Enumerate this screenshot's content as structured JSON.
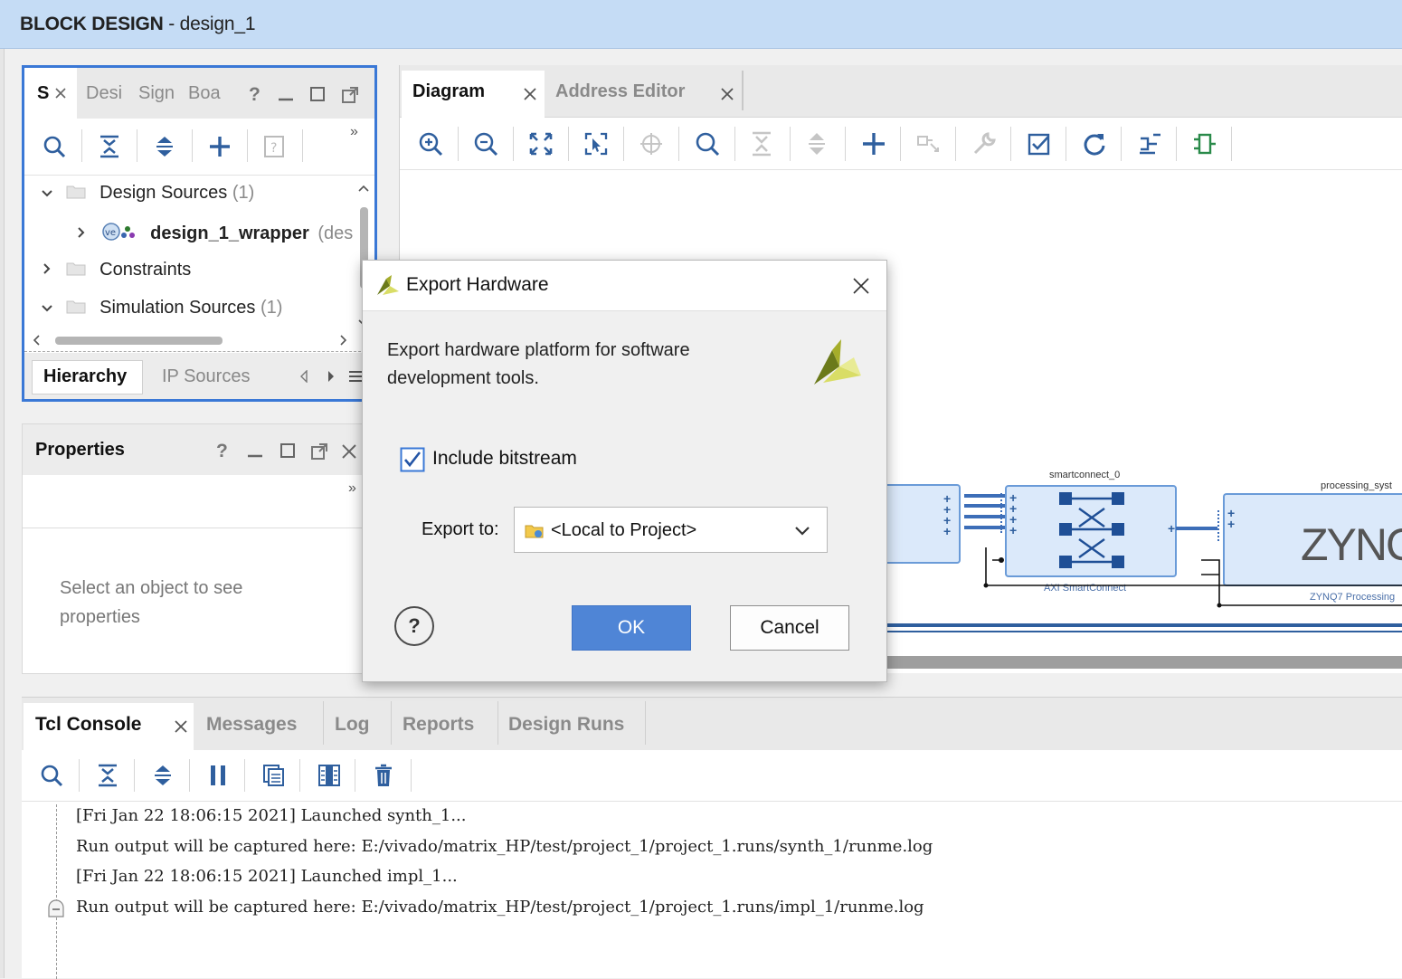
{
  "window": {
    "title_bold": "BLOCK DESIGN",
    "title_rest": " - design_1"
  },
  "sources": {
    "tabs": [
      "S",
      "Desi",
      "Sign",
      "Boa"
    ],
    "tree": [
      {
        "label": "Design Sources",
        "count": "(1)"
      },
      {
        "label": "design_1_wrapper",
        "suffix": "(des"
      },
      {
        "label": "Constraints"
      },
      {
        "label": "Simulation Sources",
        "count": "(1)"
      }
    ],
    "bottom_tabs": [
      "Hierarchy",
      "IP Sources"
    ],
    "overflow": "»"
  },
  "properties": {
    "title": "Properties",
    "empty_line1": "Select an object to see",
    "empty_line2": "properties",
    "overflow": "»"
  },
  "diagram": {
    "tabs": [
      "Diagram",
      "Address Editor"
    ],
    "blocks": {
      "smartconnect_name": "smartconnect_0",
      "smartconnect_sub": "AXI SmartConnect",
      "ps_name": "processing_syst",
      "ps_logo": "ZYNQ",
      "ps_sub": "ZYNQ7 Processing"
    }
  },
  "console": {
    "tabs": [
      "Tcl Console",
      "Messages",
      "Log",
      "Reports",
      "Design Runs"
    ],
    "lines": [
      "[Fri Jan 22 18:06:15 2021] Launched synth_1...",
      "Run output will be captured here: E:/vivado/matrix_HP/test/project_1/project_1.runs/synth_1/runme.log",
      "[Fri Jan 22 18:06:15 2021] Launched impl_1...",
      "Run output will be captured here: E:/vivado/matrix_HP/test/project_1/project_1.runs/impl_1/runme.log"
    ]
  },
  "dialog": {
    "title": "Export Hardware",
    "description_line1": "Export hardware platform for software",
    "description_line2": "development tools.",
    "include_bitstream_label": "Include bitstream",
    "include_bitstream_checked": true,
    "export_to_label": "Export to:",
    "export_to_value": "<Local to Project>",
    "ok_label": "OK",
    "cancel_label": "Cancel",
    "help_label": "?"
  },
  "colors": {
    "accent": "#3a78d6",
    "ok_button": "#4f85d6",
    "title_bar": "#c5dcf5",
    "xilinx_logo": "#b5b52a"
  }
}
